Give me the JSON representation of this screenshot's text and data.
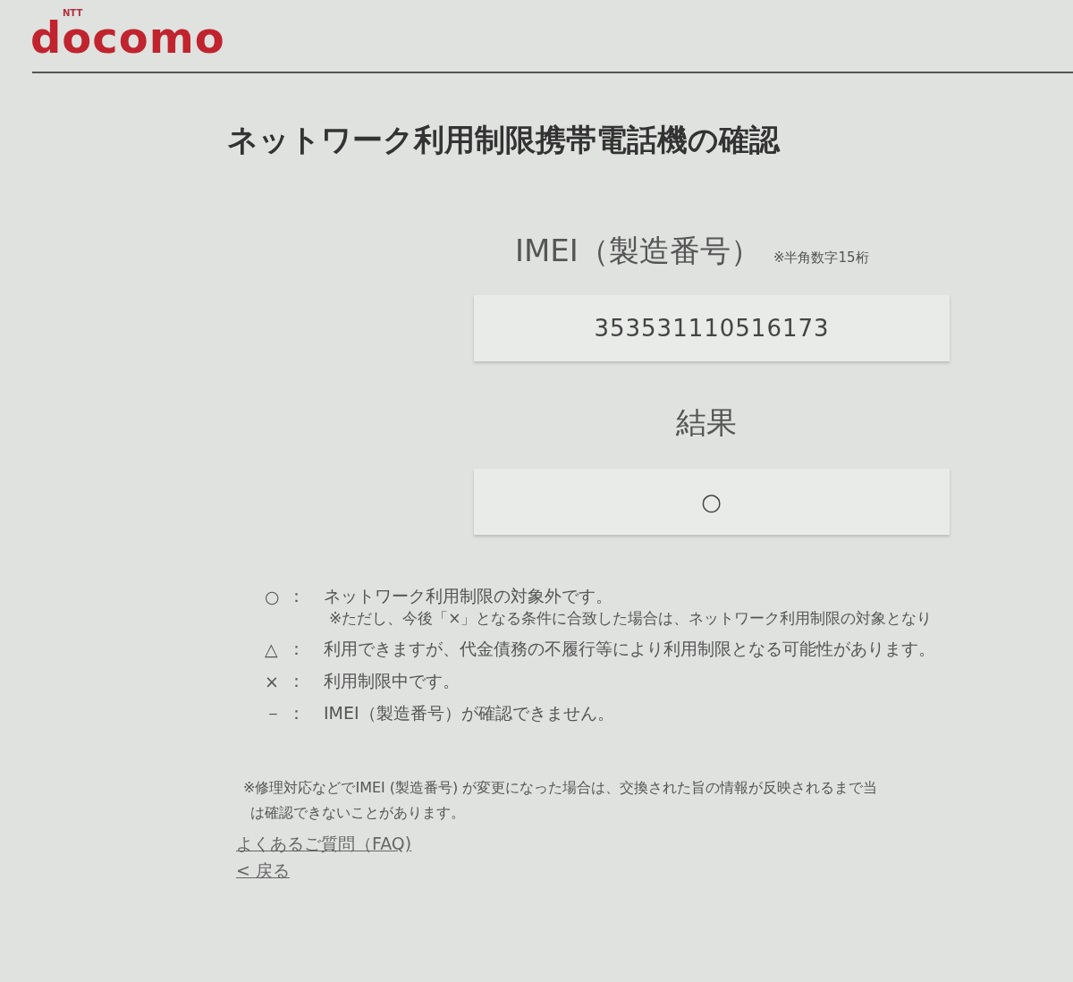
{
  "header": {
    "logo_small": "NTT",
    "logo": "docomo"
  },
  "title": "ネットワーク利用制限携帯電話機の確認",
  "imei": {
    "label": "IMEI（製造番号）",
    "note": "※半角数字15桁",
    "value": "353531110516173"
  },
  "result": {
    "label": "結果",
    "value": "○"
  },
  "legend": [
    {
      "symbol": "○",
      "separator": "：",
      "text": "ネットワーク利用制限の対象外です。",
      "note": "※ただし、今後「×」となる条件に合致した場合は、ネットワーク利用制限の対象となり"
    },
    {
      "symbol": "△",
      "separator": "：",
      "text": "利用できますが、代金債務の不履行等により利用制限となる可能性があります。"
    },
    {
      "symbol": "×",
      "separator": "：",
      "text": "利用制限中です。"
    },
    {
      "symbol": "－",
      "separator": "：",
      "text": "IMEI（製造番号）が確認できません。"
    }
  ],
  "footnote": [
    "※修理対応などでIMEI (製造番号) が変更になった場合は、交換された旨の情報が反映されるまで当",
    "は確認できないことがあります。"
  ],
  "links": [
    {
      "text": "よくあるご質問（FAQ)"
    },
    {
      "text": "< 戻る"
    }
  ]
}
